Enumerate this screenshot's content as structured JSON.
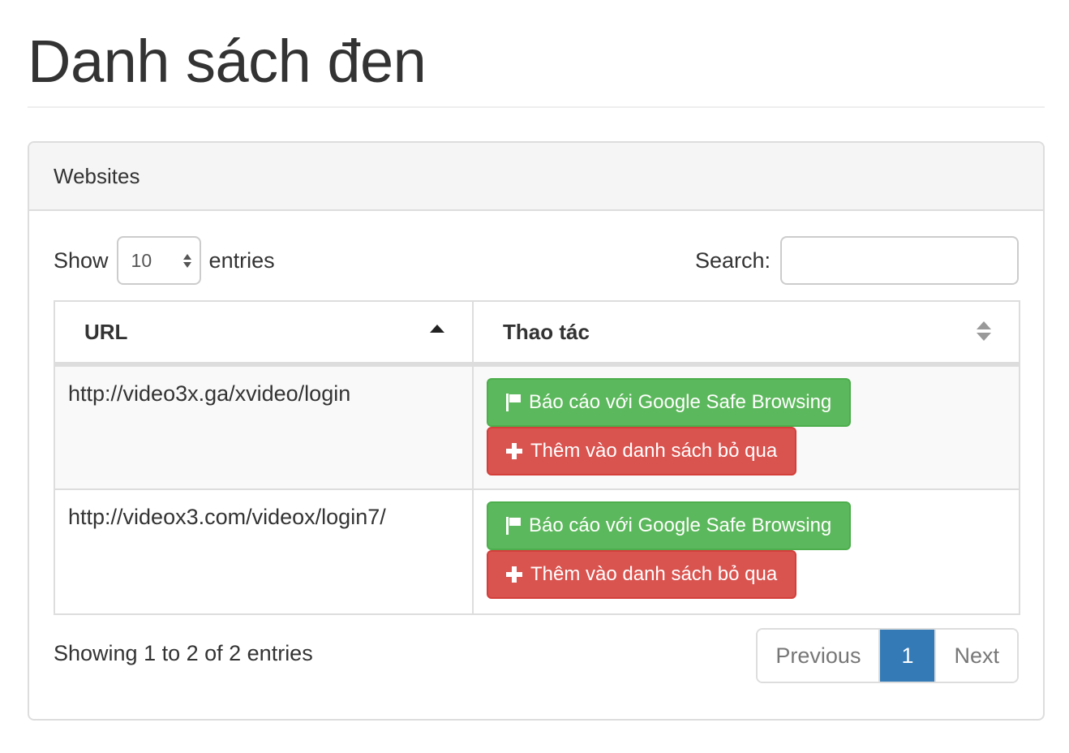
{
  "page": {
    "title": "Danh sách đen"
  },
  "panel": {
    "heading": "Websites"
  },
  "length": {
    "show_label": "Show",
    "value": "10",
    "entries_label": "entries"
  },
  "search": {
    "label": "Search:",
    "value": "",
    "placeholder": ""
  },
  "table": {
    "columns": [
      {
        "label": "URL",
        "sort": "ascending"
      },
      {
        "label": "Thao tác",
        "sort": "none"
      }
    ],
    "rows": [
      {
        "url": "http://video3x.ga/xvideo/login",
        "report_label": "Báo cáo với Google Safe Browsing",
        "ignore_label": "Thêm vào danh sách bỏ qua"
      },
      {
        "url": "http://videox3.com/videox/login7/",
        "report_label": "Báo cáo với Google Safe Browsing",
        "ignore_label": "Thêm vào danh sách bỏ qua"
      }
    ]
  },
  "footer": {
    "info": "Showing 1 to 2 of 2 entries"
  },
  "pagination": {
    "previous": "Previous",
    "current": "1",
    "next": "Next"
  },
  "colors": {
    "success": "#5cb85c",
    "danger": "#d9534f",
    "active_page": "#337ab7"
  },
  "icons": {
    "report": "flag-icon",
    "ignore": "plus-icon",
    "sort_asc": "sort-asc-icon",
    "sort_both": "sort-both-icon"
  }
}
